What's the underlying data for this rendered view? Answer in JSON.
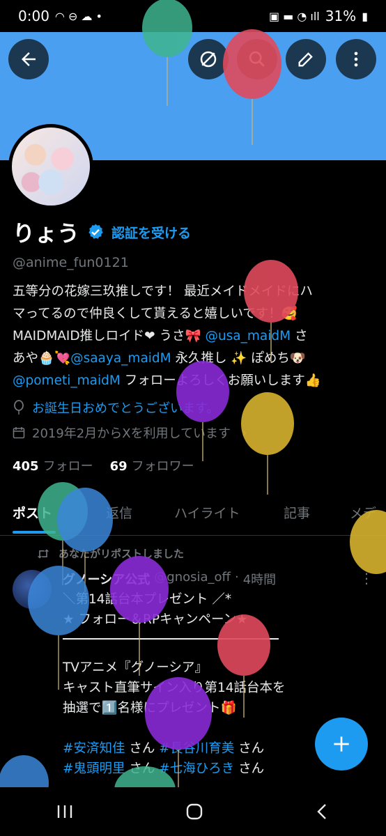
{
  "status": {
    "time": "0:00",
    "battery": "31%"
  },
  "profile": {
    "name": "りょう",
    "verify_cta": "認証を受ける",
    "handle": "@anime_fun0121",
    "bio": {
      "line1": "五等分の花嫁三玖推しです！ 最近メイドメイドにハ",
      "line2": "マってるので仲良くして貰えると嬉しいです！🥰",
      "line3a": "MAIDMAID推しロイド❤ うさ🎀 ",
      "m1": "@usa_maidM",
      "line3b": " さ",
      "line4a": "あや🧁💘",
      "m2": "@saaya_maidM",
      "line4b": " 永久推し ✨ ぽめち🐶",
      "m3": "@pometi_maidM",
      "line5b": " フォローよろしくお願いします👍"
    },
    "birthday": "お誕生日おめでとうございます。",
    "joined": "2019年2月からXを利用しています",
    "following_count": "405",
    "following_label": "フォロー",
    "followers_count": "69",
    "followers_label": "フォロワー"
  },
  "tabs": [
    "ポスト",
    "返信",
    "ハイライト",
    "記事",
    "メデ"
  ],
  "post": {
    "repost_label": "あなたがリポストしました",
    "author": "グノーシア公式",
    "author_handle": "@gnosia_off",
    "time": "4時間",
    "line1": "＼第14話台本プレゼント ／*",
    "line2": "★ フォロー＆RPキャンペーン★",
    "line3": "TVアニメ『グノーシア』",
    "line4": "キャスト直筆サイン入り第14話台本を",
    "line5": "抽選で1️⃣名様にプレゼント🎁",
    "tag1": "#安済知佳",
    "san1": " さん ",
    "tag2": "#長谷川育美",
    "san2": " さん",
    "tag3": "#鬼頭明里",
    "san3": " さん ",
    "tag4": "#七海ひろき",
    "san4": " さん"
  },
  "icons": [
    "back-arrow-icon",
    "no-image-icon",
    "search-icon",
    "edit-icon",
    "more-icon",
    "verified-badge-icon",
    "balloon-icon",
    "calendar-icon",
    "repost-icon",
    "plus-icon",
    "recent-apps-icon",
    "home-icon",
    "back-nav-icon"
  ],
  "colors": {
    "accent": "#1d9bf0",
    "banner": "#4a9ff0",
    "background": "#000000",
    "muted": "#71767b"
  }
}
